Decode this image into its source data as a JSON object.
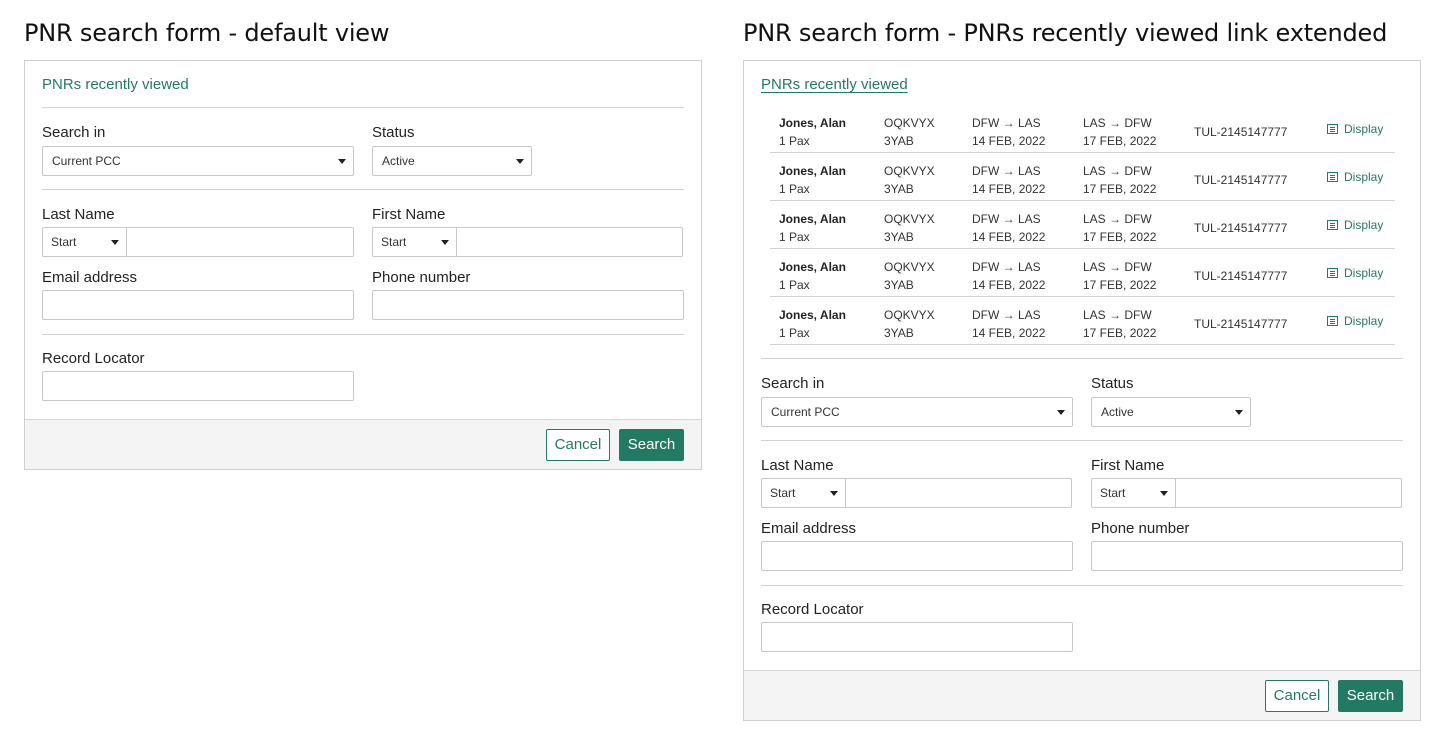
{
  "left": {
    "heading": "PNR search form - default view",
    "recent_link": "PNRs recently viewed"
  },
  "right": {
    "heading": "PNR search form - PNRs recently viewed link extended",
    "recent_link": "PNRs recently viewed"
  },
  "form": {
    "search_in_label": "Search in",
    "search_in_value": "Current PCC",
    "status_label": "Status",
    "status_value": "Active",
    "last_name_label": "Last Name",
    "last_name_mode": "Start",
    "first_name_label": "First Name",
    "first_name_mode": "Start",
    "email_label": "Email address",
    "phone_label": "Phone number",
    "record_locator_label": "Record Locator",
    "cancel": "Cancel",
    "search": "Search"
  },
  "recent": [
    {
      "name": "Jones, Alan",
      "pax": "1 Pax",
      "code1": "OQKVYX",
      "code2": "3YAB",
      "out_route": "DFW → LAS",
      "out_date": "14 FEB, 2022",
      "ret_route": "LAS → DFW",
      "ret_date": "17 FEB, 2022",
      "ref": "TUL-2145147777",
      "action": "Display"
    },
    {
      "name": "Jones, Alan",
      "pax": "1 Pax",
      "code1": "OQKVYX",
      "code2": "3YAB",
      "out_route": "DFW → LAS",
      "out_date": "14 FEB, 2022",
      "ret_route": "LAS → DFW",
      "ret_date": "17 FEB, 2022",
      "ref": "TUL-2145147777",
      "action": "Display"
    },
    {
      "name": "Jones, Alan",
      "pax": "1 Pax",
      "code1": "OQKVYX",
      "code2": "3YAB",
      "out_route": "DFW → LAS",
      "out_date": "14 FEB, 2022",
      "ret_route": "LAS → DFW",
      "ret_date": "17 FEB, 2022",
      "ref": "TUL-2145147777",
      "action": "Display"
    },
    {
      "name": "Jones, Alan",
      "pax": "1 Pax",
      "code1": "OQKVYX",
      "code2": "3YAB",
      "out_route": "DFW → LAS",
      "out_date": "14 FEB, 2022",
      "ret_route": "LAS → DFW",
      "ret_date": "17 FEB, 2022",
      "ref": "TUL-2145147777",
      "action": "Display"
    },
    {
      "name": "Jones, Alan",
      "pax": "1 Pax",
      "code1": "OQKVYX",
      "code2": "3YAB",
      "out_route": "DFW → LAS",
      "out_date": "14 FEB, 2022",
      "ret_route": "LAS → DFW",
      "ret_date": "17 FEB, 2022",
      "ref": "TUL-2145147777",
      "action": "Display"
    }
  ],
  "colors": {
    "accent": "#237a62",
    "footer_bg": "#f4f4f4",
    "border": "#cfcfcf"
  }
}
